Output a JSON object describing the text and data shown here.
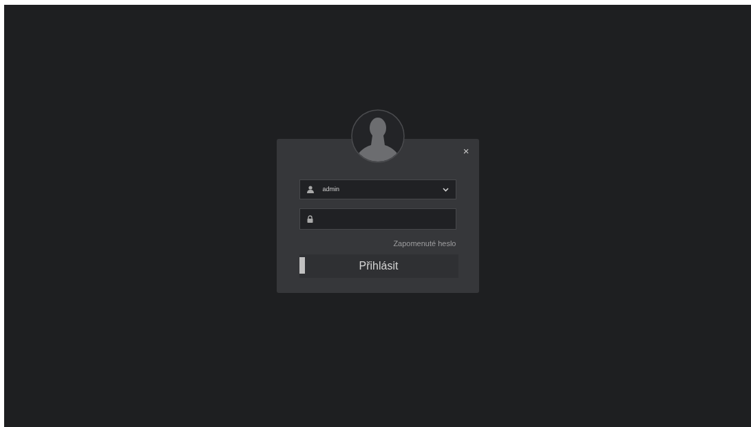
{
  "login_dialog": {
    "close_label": "×",
    "username": {
      "value": "admin"
    },
    "forgot_password_link": "Zapomenuté heslo",
    "login_button": "Přihlásit"
  }
}
